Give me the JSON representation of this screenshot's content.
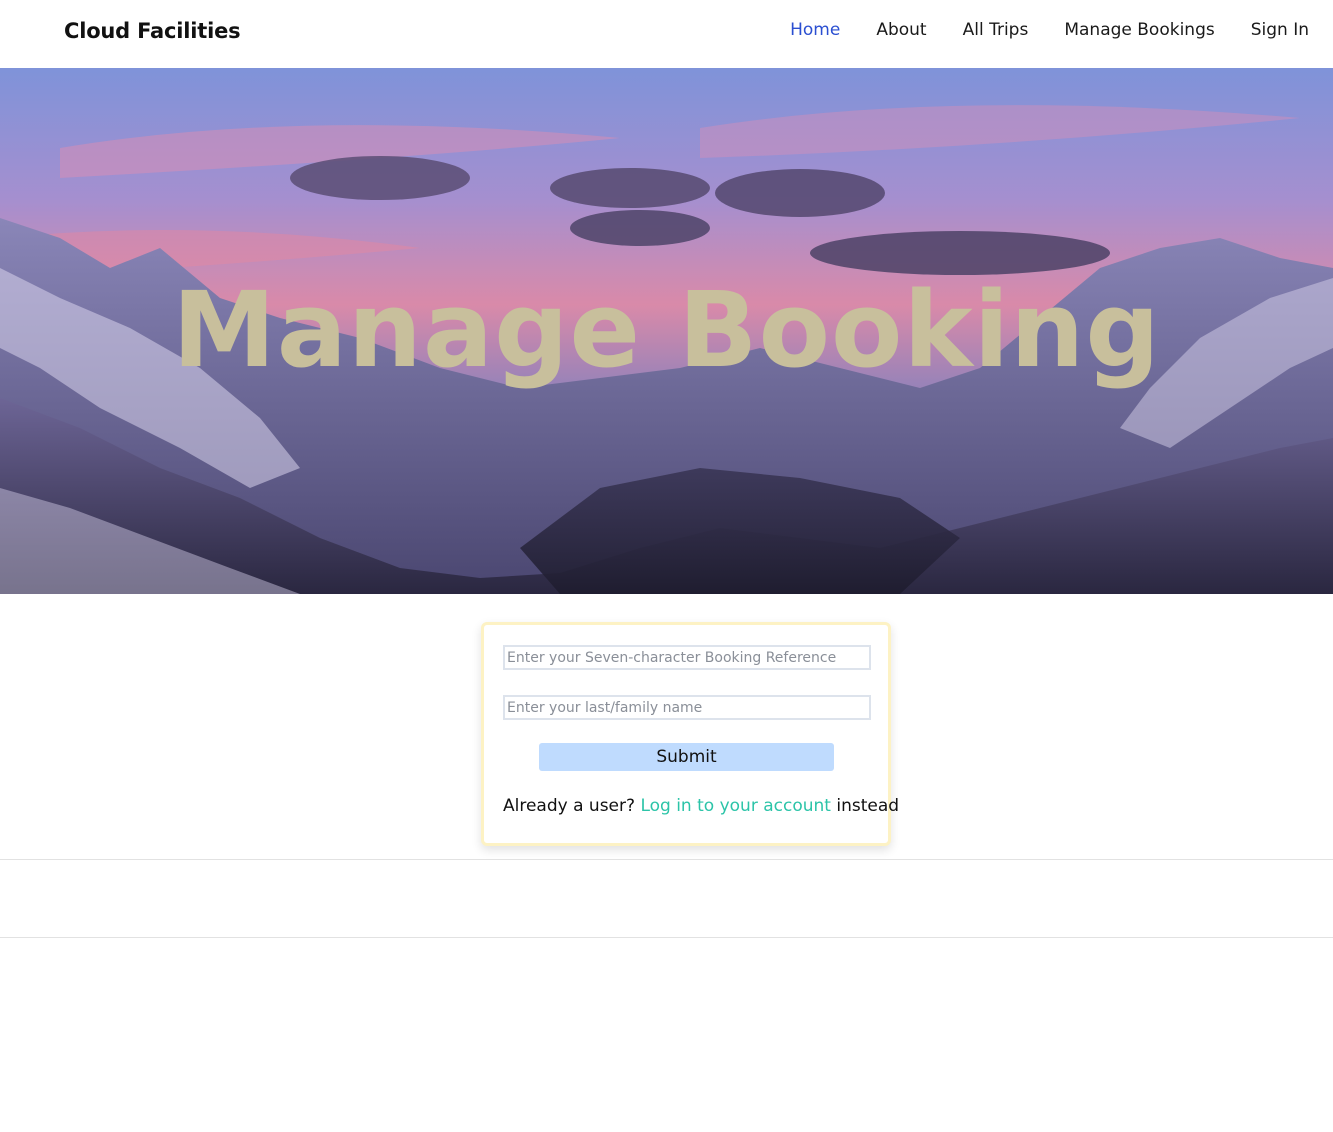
{
  "header": {
    "brand": "Cloud Facilities",
    "nav": [
      {
        "label": "Home",
        "active": true
      },
      {
        "label": "About",
        "active": false
      },
      {
        "label": "All Trips",
        "active": false
      },
      {
        "label": "Manage Bookings",
        "active": false
      },
      {
        "label": "Sign In",
        "active": false
      }
    ]
  },
  "hero": {
    "title": "Manage Booking",
    "background": "mountain-sunset-image"
  },
  "form": {
    "booking_ref_placeholder": "Enter your Seven-character Booking Reference",
    "booking_ref_value": "",
    "last_name_placeholder": "Enter your last/family name",
    "last_name_value": "",
    "submit_label": "Submit",
    "login_prefix": "Already a user? ",
    "login_link": "Log in to your account",
    "login_suffix": " instead"
  },
  "colors": {
    "nav_active": "#2b4fd1",
    "hero_title": "#c8bf9c",
    "submit_bg": "#bfdbfe",
    "link": "#2cc4a8",
    "card_border": "#fdf2c4"
  }
}
